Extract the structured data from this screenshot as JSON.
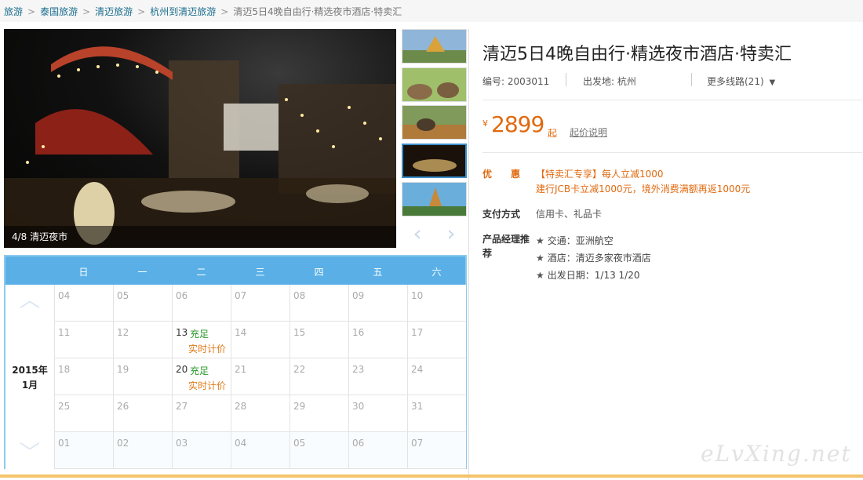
{
  "breadcrumb": {
    "items": [
      "旅游",
      "泰国旅游",
      "清迈旅游",
      "杭州到清迈旅游"
    ],
    "current": "清迈5日4晚自由行·精选夜市酒店·特卖汇",
    "separator": ">"
  },
  "gallery": {
    "caption": "4/8 清迈夜市",
    "active_thumb": 4,
    "thumb_count_visible": 5,
    "prev_icon": "chevron-left-icon",
    "next_icon": "chevron-right-icon"
  },
  "calendar": {
    "weekdays": [
      "日",
      "一",
      "二",
      "三",
      "四",
      "五",
      "六"
    ],
    "year_label": "2015年",
    "month_label": "1月",
    "weeks": [
      [
        {
          "d": "04"
        },
        {
          "d": "05"
        },
        {
          "d": "06"
        },
        {
          "d": "07"
        },
        {
          "d": "08"
        },
        {
          "d": "09"
        },
        {
          "d": "10"
        }
      ],
      [
        {
          "d": "11"
        },
        {
          "d": "12"
        },
        {
          "d": "13",
          "status": "充足",
          "price": "实时计价"
        },
        {
          "d": "14"
        },
        {
          "d": "15"
        },
        {
          "d": "16"
        },
        {
          "d": "17"
        }
      ],
      [
        {
          "d": "18"
        },
        {
          "d": "19"
        },
        {
          "d": "20",
          "status": "充足",
          "price": "实时计价"
        },
        {
          "d": "21"
        },
        {
          "d": "22"
        },
        {
          "d": "23"
        },
        {
          "d": "24"
        }
      ],
      [
        {
          "d": "25"
        },
        {
          "d": "26"
        },
        {
          "d": "27"
        },
        {
          "d": "28"
        },
        {
          "d": "29"
        },
        {
          "d": "30"
        },
        {
          "d": "31"
        }
      ],
      [
        {
          "d": "01"
        },
        {
          "d": "02"
        },
        {
          "d": "03"
        },
        {
          "d": "04"
        },
        {
          "d": "05"
        },
        {
          "d": "06"
        },
        {
          "d": "07"
        }
      ]
    ]
  },
  "product": {
    "title": "清迈5日4晚自由行·精选夜市酒店·特卖汇",
    "code": "编号: 2003011",
    "departure": "出发地: 杭州",
    "more_routes": "更多线路(21)",
    "currency": "¥",
    "price": "2899",
    "price_unit": "起",
    "price_note": "起价说明",
    "promo_label": "优　　惠",
    "promo_line1": "【特卖汇专享】每人立减1000",
    "promo_line2": "建行JCB卡立减1000元，境外消费满额再返1000元",
    "payment_label": "支付方式",
    "payment_value": "信用卡、礼品卡",
    "recommend_label": "产品经理推荐",
    "recommend_items": [
      "交通：亚洲航空",
      "酒店：清迈多家夜市酒店",
      "出发日期：1/13 1/20"
    ]
  },
  "watermark": "eLvXing.net",
  "colors": {
    "accent_orange": "#e06a10",
    "calendar_blue": "#5ab0e6",
    "link_blue": "#1a6e8e",
    "available_green": "#2a9a2a"
  }
}
